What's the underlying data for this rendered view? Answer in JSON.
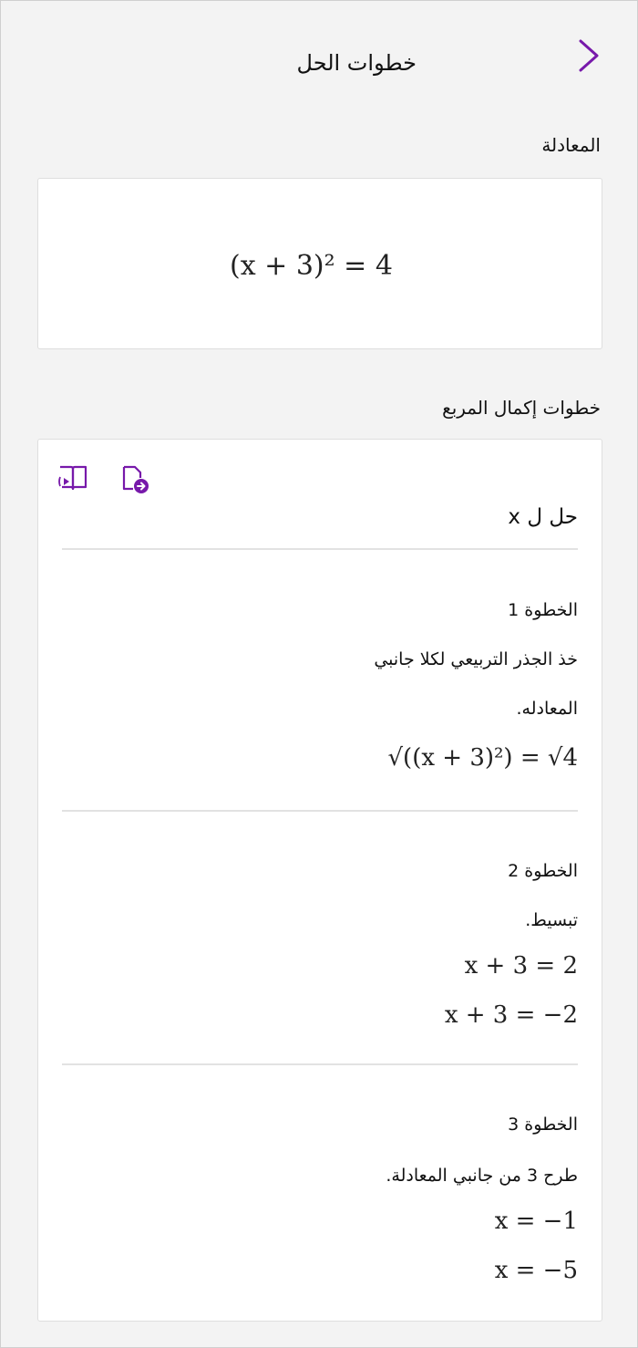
{
  "header": {
    "title": "خطوات الحل",
    "back_icon": "chevron-right-icon",
    "accent_color": "#7719aa"
  },
  "equation_section": {
    "label": "المعادلة",
    "equation": "(x + 3)² = 4"
  },
  "steps_section": {
    "label": "خطوات إكمال المربع",
    "tools": [
      {
        "icon": "immersive-reader-icon"
      },
      {
        "icon": "insert-to-page-icon"
      }
    ],
    "solve_for": "حل ل x",
    "steps": [
      {
        "title": "الخطوة 1",
        "text_line1": "خذ الجذر التربيعي لكلا جانبي",
        "text_line2": "المعادله.",
        "math": [
          "√((x + 3)²) = √4"
        ]
      },
      {
        "title": "الخطوة 2",
        "text_line1": "تبسيط.",
        "math": [
          "x + 3 = 2",
          "x + 3 = −2"
        ]
      },
      {
        "title": "الخطوة 3",
        "text_line1": "طرح 3 من جانبي المعادلة.",
        "math": [
          "x = −1",
          "x = −5"
        ]
      }
    ]
  }
}
